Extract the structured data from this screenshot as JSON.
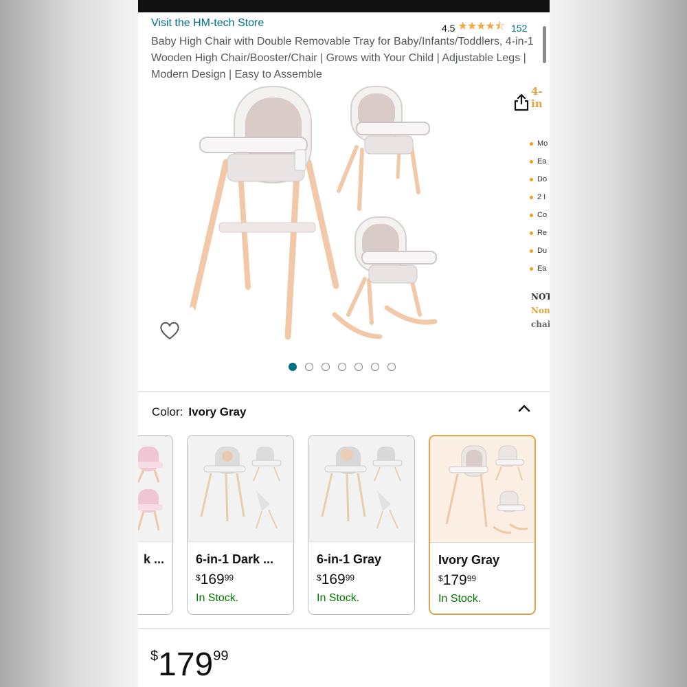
{
  "header": {
    "store_link": "Visit the HM-tech Store",
    "rating_value": "4.5",
    "rating_stars": "★★★★⯪",
    "review_count": "152"
  },
  "product": {
    "title": "Baby High Chair with Double Removable Tray for Baby/Infants/Toddlers, 4-in-1 Wooden High Chair/Booster/Chair | Grows with Your Child | Adjustable Legs | Modern Design | Easy to Assemble"
  },
  "gallery": {
    "image_count": 7,
    "active_index": 0,
    "peek": {
      "heading": "4-in",
      "bullets": [
        "Mo",
        "Ea",
        "Do",
        "2 I",
        "Co",
        "Re",
        "Du",
        "Ea"
      ],
      "note_lines": [
        "NOT",
        "Non",
        "chai"
      ]
    }
  },
  "colors": {
    "label": "Color:",
    "selected": "Ivory Gray",
    "swatches": [
      {
        "name": "k ...",
        "price_symbol": "",
        "price_whole": "",
        "price_fraction": "",
        "stock": ""
      },
      {
        "name": "6-in-1 Dark ...",
        "price_symbol": "$",
        "price_whole": "169",
        "price_fraction": "99",
        "stock": "In Stock."
      },
      {
        "name": "6-in-1 Gray",
        "price_symbol": "$",
        "price_whole": "169",
        "price_fraction": "99",
        "stock": "In Stock."
      },
      {
        "name": "Ivory Gray",
        "price_symbol": "$",
        "price_whole": "179",
        "price_fraction": "99",
        "stock": "In Stock."
      }
    ]
  },
  "price": {
    "symbol": "$",
    "whole": "179",
    "fraction": "99"
  },
  "theme": {
    "link_color": "#007185",
    "star_color": "#f3a847",
    "stock_color": "#007600",
    "selected_border": "#e0a44a"
  }
}
